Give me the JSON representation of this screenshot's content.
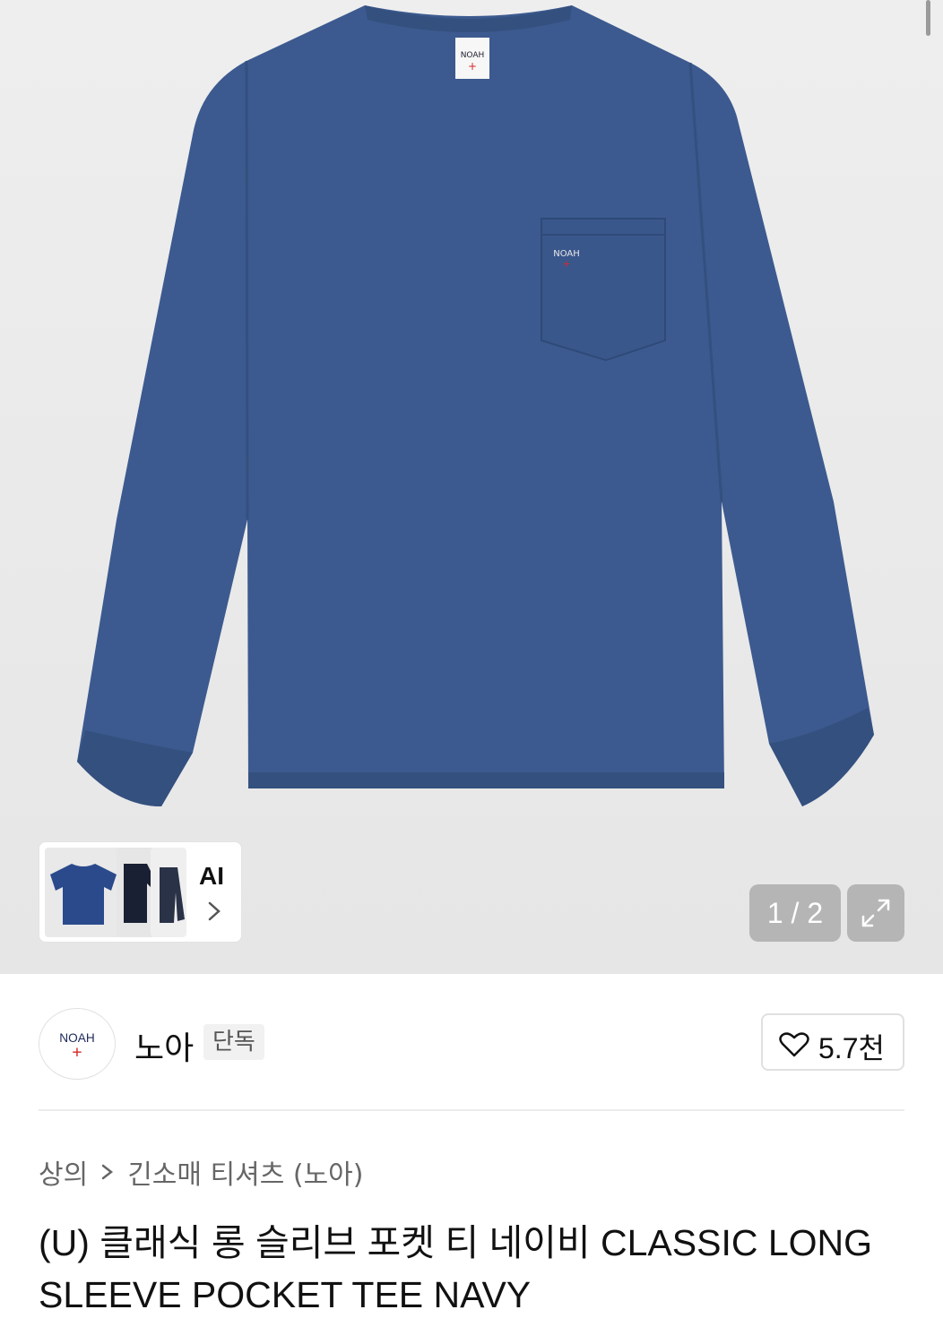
{
  "gallery": {
    "ai_label": "AI",
    "page_current": "1",
    "page_total": "2",
    "page_text": "1 / 2",
    "main_garment_color": "#3c5a8f",
    "logo_text": "NOAH"
  },
  "brand": {
    "logo_text": "NOAH",
    "name": "노아",
    "badge": "단독",
    "likes": "5.7천"
  },
  "breadcrumb": {
    "category": "상의",
    "subcategory": "긴소매 티셔츠 (노아)"
  },
  "product": {
    "title": "(U) 클래식 롱 슬리브 포켓 티 네이비 CLASSIC LONG SLEEVE POCKET TEE NAVY"
  },
  "colors": {
    "accent_red": "#d62828",
    "navy": "#3c5a8f"
  }
}
